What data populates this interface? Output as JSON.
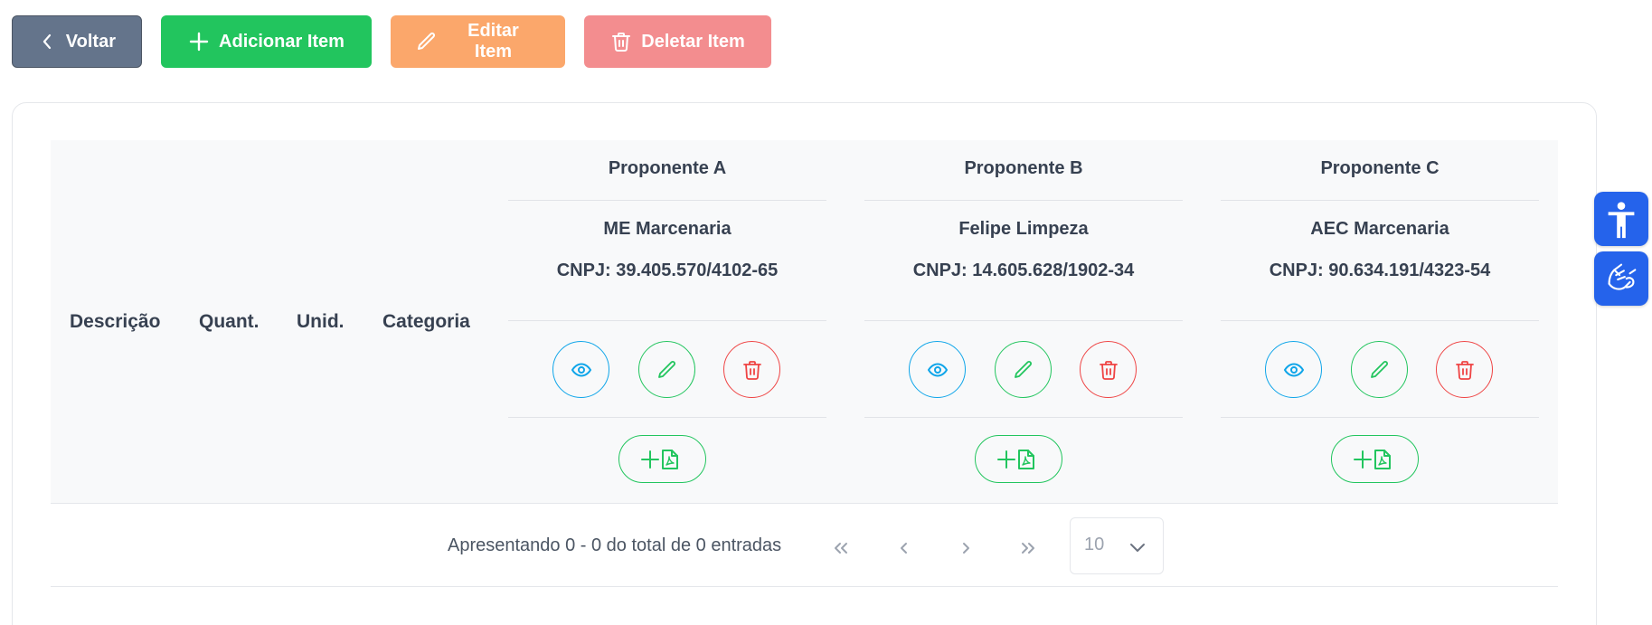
{
  "toolbar": {
    "back_label": "Voltar",
    "add_label": "Adicionar Item",
    "edit_label": "Editar Item",
    "delete_label": "Deletar Item"
  },
  "table": {
    "columns": [
      "Descrição",
      "Quant.",
      "Unid.",
      "Categoria"
    ],
    "proponents": [
      {
        "title": "Proponente A",
        "name": "ME Marcenaria",
        "cnpj": "CNPJ: 39.405.570/4102-65"
      },
      {
        "title": "Proponente B",
        "name": "Felipe Limpeza",
        "cnpj": "CNPJ: 14.605.628/1902-34"
      },
      {
        "title": "Proponente C",
        "name": "AEC Marcenaria",
        "cnpj": "CNPJ: 90.634.191/4323-54"
      }
    ]
  },
  "pagination": {
    "summary": "Apresentando 0 - 0 do total de 0 entradas",
    "page_size": "10"
  },
  "colors": {
    "back": "#64748b",
    "add": "#22c55e",
    "edit": "#fba76b",
    "delete": "#f38d8f",
    "view_outline": "#0ea5e9",
    "accessibility": "#2563eb"
  },
  "icons": {
    "back": "chevron-left-icon",
    "add": "plus-icon",
    "edit": "pencil-icon",
    "delete": "trash-icon",
    "view": "eye-icon",
    "attach": "add-pdf-icon",
    "accessibility": "accessibility-icon",
    "sign_language": "sign-language-icon"
  }
}
